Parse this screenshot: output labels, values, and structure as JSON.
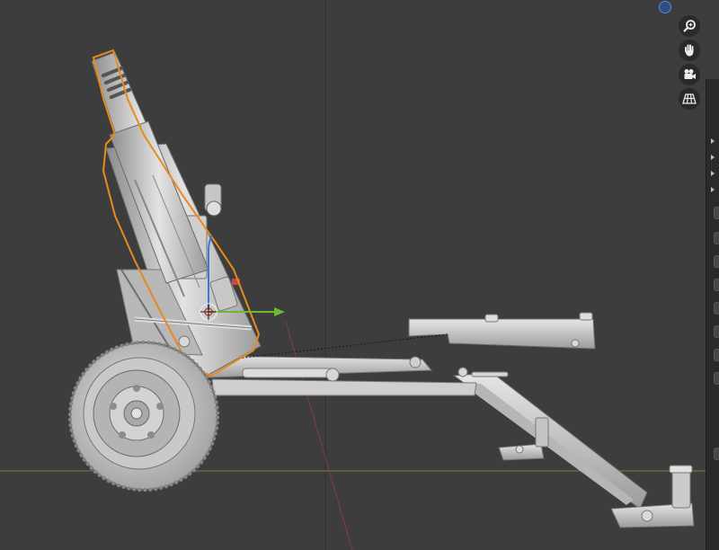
{
  "viewport": {
    "background": "#3d3d3d",
    "axis_x_color": "#6a8a3a",
    "axis_y_color": "#8a3a3a",
    "selection_color": "#e88a1e"
  },
  "navigation": {
    "gizmo": {
      "icon": "navigation-gizmo-icon",
      "color": "#2e4f86"
    },
    "buttons": [
      {
        "name": "zoom",
        "icon": "zoom-magnifier-icon"
      },
      {
        "name": "pan",
        "icon": "pan-hand-icon"
      },
      {
        "name": "camera",
        "icon": "camera-view-icon"
      },
      {
        "name": "perspective",
        "icon": "perspective-grid-icon"
      }
    ]
  },
  "object": {
    "description_icon": "howitzer-model-icon",
    "selected_part": "barrel-cradle",
    "transform_gizmo": "move-gizmo-icon"
  }
}
